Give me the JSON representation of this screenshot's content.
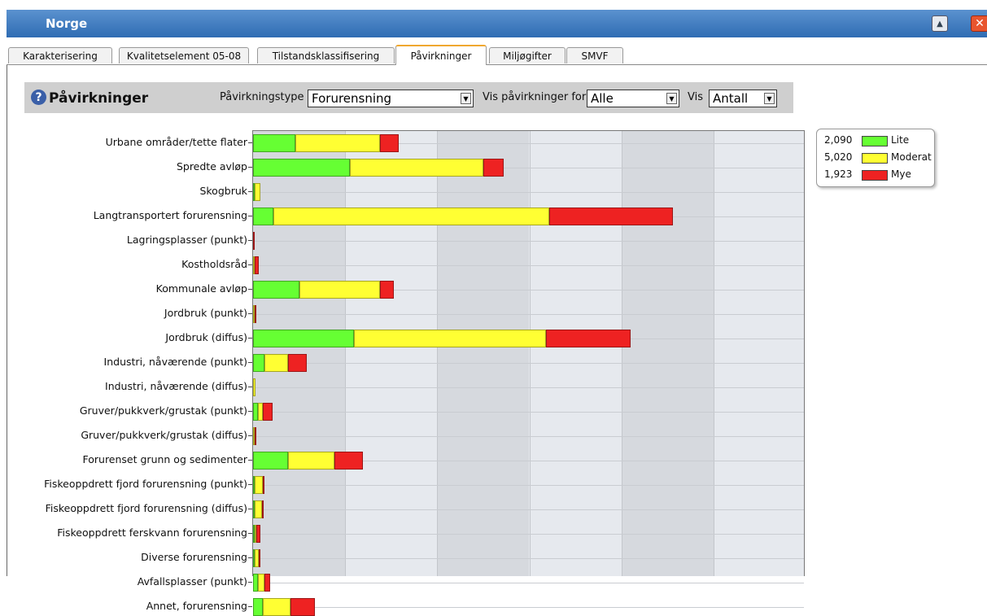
{
  "window": {
    "title": "Norge",
    "minimize_icon": "▲",
    "close_icon": "✕"
  },
  "tabs": [
    {
      "label": "Karakterisering"
    },
    {
      "label": "Kvalitetselement 05-08"
    },
    {
      "label": "Tilstandsklassifisering"
    },
    {
      "label": "Påvirkninger",
      "active": true
    },
    {
      "label": "Miljøgifter"
    },
    {
      "label": "SMVF"
    }
  ],
  "toolbar": {
    "help_icon": "?",
    "title": "Påvirkninger",
    "type_label": "Påvirkningstype",
    "type_value": "Forurensning",
    "show_for_label": "Vis påvirkninger for",
    "show_for_value": "Alle",
    "show_label": "Vis",
    "show_value": "Antall"
  },
  "chart_data": {
    "type": "bar",
    "orientation": "horizontal",
    "stacked": true,
    "categories": [
      "Urbane områder/tette flater",
      "Spredte avløp",
      "Skogbruk",
      "Langtransportert forurensning",
      "Lagringsplasser (punkt)",
      "Kostholdsråd",
      "Kommunale avløp",
      "Jordbruk (punkt)",
      "Jordbruk (diffus)",
      "Industri, nåværende (punkt)",
      "Industri, nåværende (diffus)",
      "Gruver/pukkverk/grustak (punkt)",
      "Gruver/pukkverk/grustak (diffus)",
      "Forurenset grunn og sedimenter",
      "Fiskeoppdrett fjord forurensning (punkt)",
      "Fiskeoppdrett fjord forurensning (diffus)",
      "Fiskeoppdrett ferskvann forurensning",
      "Diverse forurensning",
      "Avfallsplasser (punkt)",
      "Annet, forurensning"
    ],
    "series": [
      {
        "name": "Lite",
        "color": "#66ff33",
        "values": [
          230,
          525,
          5,
          110,
          0,
          0,
          250,
          0,
          550,
          60,
          0,
          25,
          0,
          190,
          8,
          2,
          6,
          5,
          25,
          55
        ]
      },
      {
        "name": "Moderat",
        "color": "#ffff33",
        "values": [
          460,
          725,
          30,
          1500,
          0,
          5,
          440,
          5,
          1040,
          130,
          12,
          30,
          4,
          250,
          45,
          40,
          8,
          20,
          35,
          150
        ]
      },
      {
        "name": "Mye",
        "color": "#ee2222",
        "values": [
          100,
          110,
          0,
          670,
          8,
          22,
          75,
          5,
          460,
          100,
          0,
          50,
          4,
          155,
          5,
          5,
          20,
          5,
          35,
          130
        ]
      }
    ],
    "xlim": [
      0,
      3000
    ],
    "grid": true,
    "legend": {
      "placement": "top-right outside",
      "entries": [
        {
          "count": "2,090",
          "label": "Lite"
        },
        {
          "count": "5,020",
          "label": "Moderat"
        },
        {
          "count": "1,923",
          "label": "Mye"
        }
      ]
    }
  }
}
